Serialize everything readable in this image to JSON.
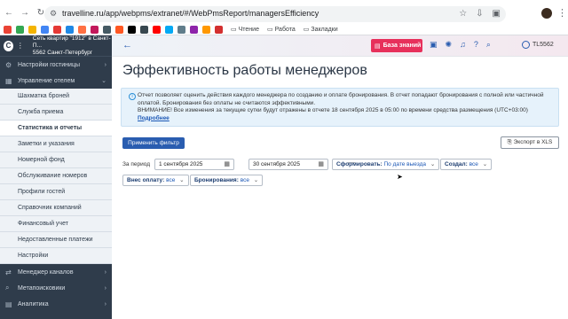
{
  "browser": {
    "url": "travelline.ru/app/webpms/extranet/#/WebPmsReport/managersEfficiency",
    "bookmarks": [
      "Чтение",
      "Работа",
      "Закладки"
    ],
    "bookmark_colors": [
      "#ea4335",
      "#34a853",
      "#f4b400",
      "#4285f4",
      "#e53935",
      "#1e88e5",
      "#ff7043",
      "#c2185b",
      "#455a64",
      "#ff5722",
      "#000000",
      "#37474f",
      "#ff0000",
      "#03a9f4",
      "#607d8b",
      "#8e24aa",
      "#ff9800",
      "#d32f2f"
    ]
  },
  "sidebar": {
    "logo_letter": "C",
    "hotel_name": "Сеть квартир \"1912\" в Санкт-П...",
    "hotel_sub": "5562 Санкт-Петербург",
    "sections": [
      {
        "label": "Настройки гостиницы",
        "icon": "gear-icon"
      },
      {
        "label": "Управление отелем",
        "icon": "grid-icon"
      }
    ],
    "sub_items": [
      "Шахматка броней",
      "Служба приема",
      "Статистика и отчеты",
      "Заметки и указания",
      "Номерной фонд",
      "Обслуживание номеров",
      "Профили гостей",
      "Справочник компаний",
      "Финансовый учет",
      "Недоставленные платежи",
      "Настройки"
    ],
    "active_sub": 2,
    "bottom_sections": [
      {
        "label": "Менеджер каналов",
        "icon": "channels-icon"
      },
      {
        "label": "Метапоисковики",
        "icon": "search-icon"
      },
      {
        "label": "Аналитика",
        "icon": "chart-icon"
      }
    ]
  },
  "topbar": {
    "knowledge_base": "База знаний",
    "user": "TL5562"
  },
  "main": {
    "title": "Эффективность работы менеджеров",
    "info_text": "Отчет позволяет оценить действия каждого менеджера по созданию и оплате бронирования. В отчет попадают бронирования с полной или частичной оплатой. Бронирования без оплаты не считаются эффективными.",
    "info_warning": "ВНИМАНИЕ! Все изменения за текущие сутки будут отражены в отчете 18 сентября 2025 в 05:00 по времени средства размещения (UTC+03:00)",
    "info_link": "Подробнее",
    "apply_button": "Применить фильтр",
    "export_button": "Экспорт в XLS",
    "period_label": "За период",
    "date_from": "1 сентября 2025",
    "date_to": "30 сентября 2025",
    "filters": {
      "form_label": "Сформировать:",
      "form_value": "По дате выезда",
      "created_label": "Создал:",
      "created_value": "все",
      "outside_label": "Внес оплату:",
      "outside_value": "все",
      "bookings_label": "Бронирования:",
      "bookings_value": "все"
    }
  }
}
